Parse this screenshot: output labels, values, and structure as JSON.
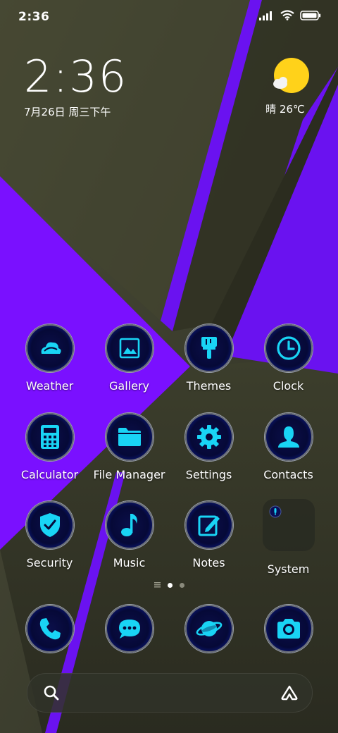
{
  "status_bar": {
    "time": "2:36",
    "icons": [
      "signal-icon",
      "wifi-icon",
      "battery-icon"
    ]
  },
  "clock_widget": {
    "time": "2:36",
    "date": "7月26日 周三下午"
  },
  "weather_widget": {
    "icon": "partly-sunny-icon",
    "text": "晴 26℃"
  },
  "apps": [
    {
      "label": "Weather",
      "icon": "weather-icon"
    },
    {
      "label": "Gallery",
      "icon": "gallery-icon"
    },
    {
      "label": "Themes",
      "icon": "brush-icon"
    },
    {
      "label": "Clock",
      "icon": "clock-icon"
    },
    {
      "label": "Calculator",
      "icon": "calculator-icon"
    },
    {
      "label": "File Manager",
      "icon": "folder-icon"
    },
    {
      "label": "Settings",
      "icon": "gear-icon"
    },
    {
      "label": "Contacts",
      "icon": "person-icon"
    },
    {
      "label": "Security",
      "icon": "shield-icon"
    },
    {
      "label": "Music",
      "icon": "music-note-icon"
    },
    {
      "label": "Notes",
      "icon": "notes-icon"
    },
    {
      "label": "System",
      "icon": "folder-group-icon"
    }
  ],
  "page_indicator": {
    "pages": 2,
    "active": 1
  },
  "dock": [
    {
      "icon": "phone-icon"
    },
    {
      "icon": "message-icon"
    },
    {
      "icon": "browser-icon"
    },
    {
      "icon": "camera-icon"
    }
  ],
  "search_bar": {
    "icon": "search-icon",
    "right_icon": "assistant-icon"
  },
  "colors": {
    "accent": "#19d4f5",
    "wallpaper_purple": "#7a10ff",
    "wallpaper_olive": "#3f4130",
    "sun": "#ffd21a"
  }
}
